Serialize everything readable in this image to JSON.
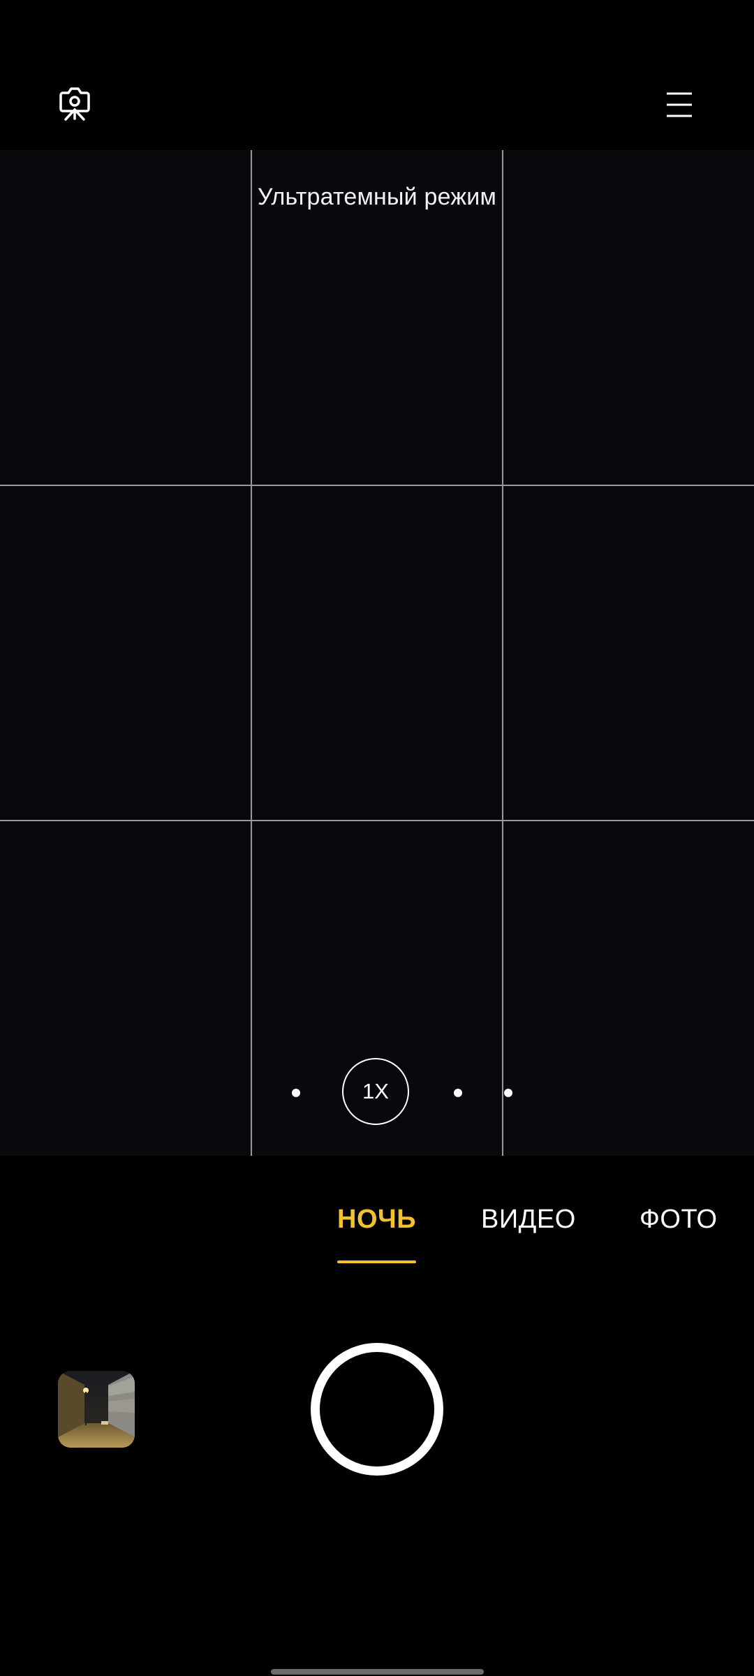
{
  "top_bar": {
    "left_icon": "camera-settings-icon",
    "right_icon": "menu-icon"
  },
  "viewfinder": {
    "mode_hint": "Ультратемный режим",
    "grid": "3x3",
    "zoom": {
      "label": "1X"
    }
  },
  "modes": {
    "items": [
      {
        "label": "НОЧЬ",
        "active": true
      },
      {
        "label": "ВИДЕО",
        "active": false
      },
      {
        "label": "ФОТО",
        "active": false
      }
    ]
  },
  "colors": {
    "accent": "#f2c12e",
    "background": "#000000",
    "viewfinder": "#07090d"
  },
  "bottom": {
    "gallery_thumbnail": "last-photo-thumbnail",
    "shutter": "shutter-button-icon"
  }
}
